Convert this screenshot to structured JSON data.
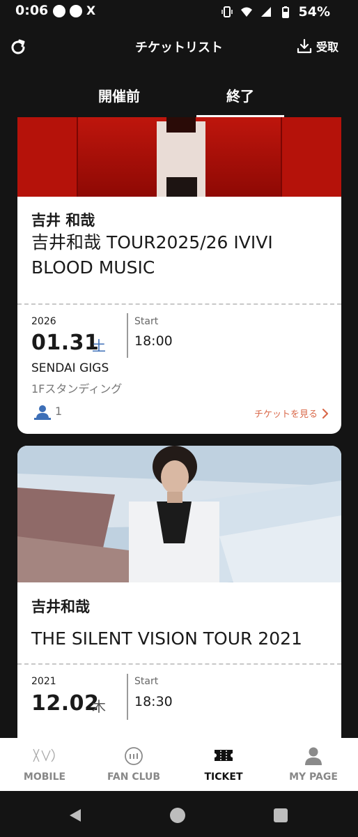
{
  "status_bar": {
    "time": "0:06",
    "battery": "54%",
    "x_glyph": "X"
  },
  "header": {
    "title": "チケットリスト",
    "receive_label": "受取"
  },
  "tabs": [
    {
      "label": "開催前",
      "active": false
    },
    {
      "label": "終了",
      "active": true
    }
  ],
  "tickets": [
    {
      "artist": "吉井 和哉",
      "title": "吉井和哉 TOUR2025/26 IVIVI BLOOD MUSIC",
      "year": "2026",
      "date": "01.31",
      "weekday": "土",
      "start_label": "Start",
      "start_time": "18:00",
      "venue": "SENDAI GIGS",
      "seat": "1Fスタンディング",
      "count": "1",
      "view_label": "チケットを見る"
    },
    {
      "artist": "吉井和哉",
      "title": "THE SILENT VISION TOUR 2021",
      "year": "2021",
      "date": "12.02",
      "weekday": "木",
      "start_label": "Start",
      "start_time": "18:30"
    }
  ],
  "bottom_nav": [
    {
      "label": "MOBILE",
      "icon": "mobile-logo-icon",
      "active": false
    },
    {
      "label": "FAN CLUB",
      "icon": "fanclub-441-icon",
      "active": false
    },
    {
      "label": "TICKET",
      "icon": "ticket-icon",
      "active": true
    },
    {
      "label": "MY PAGE",
      "icon": "user-icon",
      "active": false
    }
  ],
  "colors": {
    "weekday_sat": "#3d6fb7",
    "view_ticket": "#d9694a",
    "background": "#141414"
  }
}
